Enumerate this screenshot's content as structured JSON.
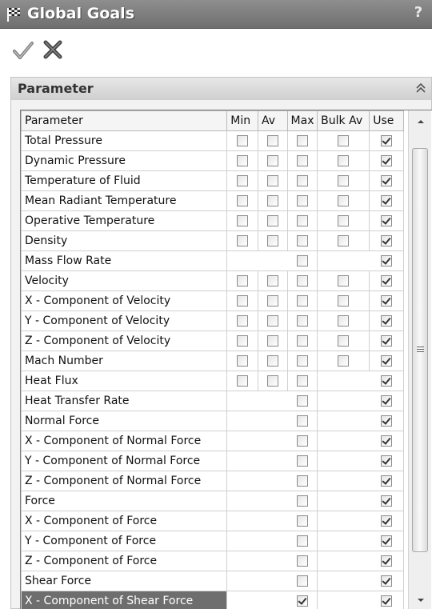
{
  "window": {
    "title": "Global Goals",
    "help_label": "?",
    "icon": "checkered-flag-icon"
  },
  "actions": {
    "ok_icon": "checkmark-icon",
    "cancel_icon": "close-x-icon"
  },
  "group": {
    "label": "Parameter",
    "collapse_icon": "double-chevron-up-icon"
  },
  "table": {
    "columns": [
      "Parameter",
      "Min",
      "Av",
      "Max",
      "Bulk Av",
      "Use"
    ],
    "rows": [
      {
        "name": "Total Pressure",
        "min": false,
        "av": false,
        "max": false,
        "bulk": false,
        "use": true
      },
      {
        "name": "Dynamic Pressure",
        "min": false,
        "av": false,
        "max": false,
        "bulk": false,
        "use": true
      },
      {
        "name": "Temperature of Fluid",
        "min": false,
        "av": false,
        "max": false,
        "bulk": false,
        "use": true
      },
      {
        "name": "Mean Radiant Temperature",
        "min": false,
        "av": false,
        "max": false,
        "bulk": false,
        "use": true
      },
      {
        "name": "Operative Temperature",
        "min": false,
        "av": false,
        "max": false,
        "bulk": false,
        "use": true
      },
      {
        "name": "Density",
        "min": false,
        "av": false,
        "max": false,
        "bulk": false,
        "use": true
      },
      {
        "name": "Mass Flow Rate",
        "min": null,
        "av": null,
        "max": false,
        "bulk": null,
        "use": true
      },
      {
        "name": "Velocity",
        "min": false,
        "av": false,
        "max": false,
        "bulk": false,
        "use": true
      },
      {
        "name": "X - Component of Velocity",
        "min": false,
        "av": false,
        "max": false,
        "bulk": false,
        "use": true
      },
      {
        "name": "Y - Component of Velocity",
        "min": false,
        "av": false,
        "max": false,
        "bulk": false,
        "use": true
      },
      {
        "name": "Z - Component of Velocity",
        "min": false,
        "av": false,
        "max": false,
        "bulk": false,
        "use": true
      },
      {
        "name": "Mach Number",
        "min": false,
        "av": false,
        "max": false,
        "bulk": false,
        "use": true
      },
      {
        "name": "Heat Flux",
        "min": false,
        "av": false,
        "max": false,
        "bulk": null,
        "use": true
      },
      {
        "name": "Heat Transfer Rate",
        "min": null,
        "av": null,
        "max": false,
        "bulk": null,
        "use": true
      },
      {
        "name": "Normal Force",
        "min": null,
        "av": null,
        "max": false,
        "bulk": null,
        "use": true
      },
      {
        "name": "X - Component of Normal Force",
        "min": null,
        "av": null,
        "max": false,
        "bulk": null,
        "use": true
      },
      {
        "name": "Y - Component of Normal Force",
        "min": null,
        "av": null,
        "max": false,
        "bulk": null,
        "use": true
      },
      {
        "name": "Z - Component of Normal Force",
        "min": null,
        "av": null,
        "max": false,
        "bulk": null,
        "use": true
      },
      {
        "name": "Force",
        "min": null,
        "av": null,
        "max": false,
        "bulk": null,
        "use": true
      },
      {
        "name": "X - Component of Force",
        "min": null,
        "av": null,
        "max": false,
        "bulk": null,
        "use": true
      },
      {
        "name": "Y - Component of Force",
        "min": null,
        "av": null,
        "max": false,
        "bulk": null,
        "use": true
      },
      {
        "name": "Z - Component of Force",
        "min": null,
        "av": null,
        "max": false,
        "bulk": null,
        "use": true
      },
      {
        "name": "Shear Force",
        "min": null,
        "av": null,
        "max": false,
        "bulk": null,
        "use": true
      },
      {
        "name": "X - Component of Shear Force",
        "min": null,
        "av": null,
        "max": true,
        "bulk": null,
        "use": true,
        "selected": true
      }
    ]
  },
  "scrollbar": {
    "up_icon": "arrow-up-icon",
    "down_icon": "arrow-down-icon",
    "grip_icon": "scroll-grip-icon"
  },
  "colors": {
    "titlebar": "#7a7a7a",
    "selected_row": "#6e6e6e",
    "panel": "#f2f2f2"
  }
}
